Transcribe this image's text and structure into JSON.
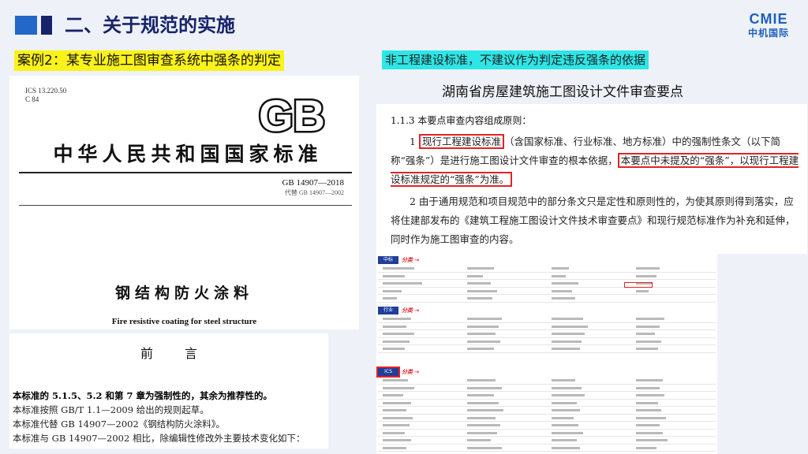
{
  "header": {
    "title": "二、关于规范的实施",
    "logo_top": "CMIE",
    "logo_bottom": "中机国际"
  },
  "case_label": "案例2：某专业施工图审查系统中强条的判定",
  "note": "非工程建设标准，不建议作为判定违反强条的依据",
  "gb_doc": {
    "ics": "ICS 13.220.50",
    "ccs": "C 84",
    "logo_text": "GB",
    "standard_name": "中华人民共和国国家标准",
    "number": "GB 14907—2018",
    "replaces": "代替 GB 14907—2002",
    "title_cn": "钢结构防火涂料",
    "title_en": "Fire resistive coating for steel structure"
  },
  "foreword": {
    "heading": "前言",
    "line1": "本标准的 5.1.5、5.2 和第 7 章为强制性的，其余为推荐性的。",
    "line2": "本标准按照 GB/T 1.1—2009 给出的规则起草。",
    "line3": "本标准代替 GB 14907—2002《钢结构防火涂料》。",
    "line4": "本标准与 GB 14907—2002 相比，除编辑性修改外主要技术变化如下："
  },
  "hunan": {
    "title": "湖南省房屋建筑施工图设计文件审查要点",
    "section": "1.1.3  本要点审查内容组成原则：",
    "p1_num": "1 ",
    "p1_box1": "现行工程建设标准",
    "p1_a": "（含国家标准、行业标准、地方标准）中的强制性条文（以下简称“强条”）是进行施工图设计文件审查的根本依据，",
    "p1_box2a": "本要点中未提及的“强条”，以现",
    "p1_box2b": "行工程建设标准规定的“强条”为准。",
    "p2": "2 由于通用规范和项目规范中的部分条文只是定性和原则性的，为使其原则得到落实，应将住建部发布的《建筑工程施工图设计文件技术审查要点》和现行规范标准作为补充和延伸，同时作为施工图审查的内容。"
  },
  "table_sections": [
    {
      "tag": "中标",
      "label": "分类 →"
    },
    {
      "tag": "行业",
      "label": "分类 →"
    },
    {
      "tag": "ICS",
      "label": "分类 →"
    }
  ],
  "colors": {
    "accent": "#2367c9",
    "dark": "#17246a",
    "highlight": "#fbf21a",
    "cyan": "#2de6e6",
    "red": "#e02424"
  }
}
